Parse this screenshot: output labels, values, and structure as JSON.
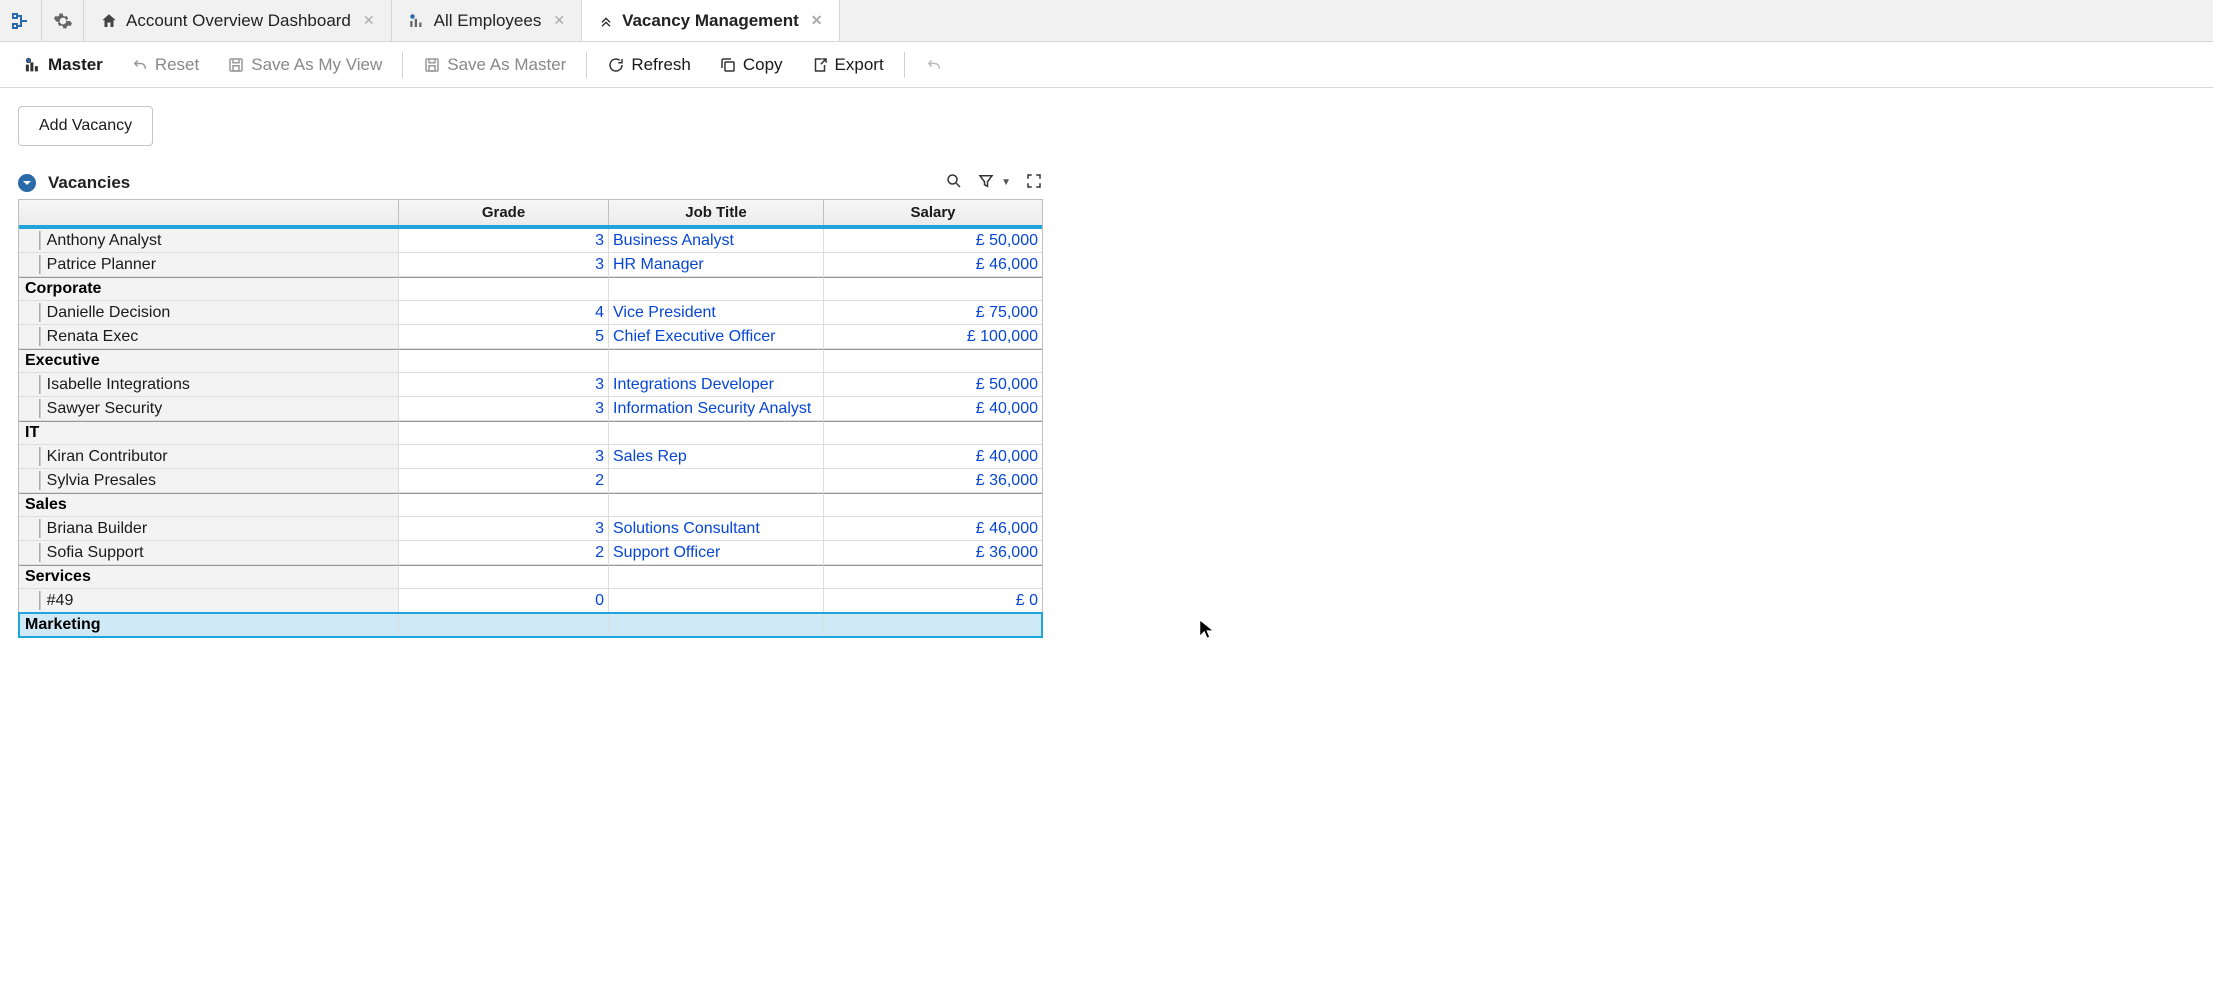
{
  "tabs": [
    {
      "label": "Account Overview Dashboard",
      "active": false,
      "icon": "home"
    },
    {
      "label": "All Employees",
      "active": false,
      "icon": "chart"
    },
    {
      "label": "Vacancy Management",
      "active": true,
      "icon": "chevrons"
    }
  ],
  "toolbar": {
    "master": "Master",
    "reset": "Reset",
    "saveView": "Save As My View",
    "saveMaster": "Save As Master",
    "refresh": "Refresh",
    "copy": "Copy",
    "export": "Export"
  },
  "actions": {
    "add_vacancy": "Add Vacancy"
  },
  "panel": {
    "title": "Vacancies"
  },
  "columns": {
    "grade": "Grade",
    "job_title": "Job Title",
    "salary": "Salary"
  },
  "rows": [
    {
      "type": "item",
      "name": "Anthony Analyst",
      "grade": "3",
      "job": "Business Analyst",
      "salary": "£ 50,000"
    },
    {
      "type": "item",
      "name": "Patrice Planner",
      "grade": "3",
      "job": "HR Manager",
      "salary": "£ 46,000"
    },
    {
      "type": "group",
      "name": "Corporate"
    },
    {
      "type": "item",
      "name": "Danielle Decision",
      "grade": "4",
      "job": "Vice President",
      "salary": "£ 75,000"
    },
    {
      "type": "item",
      "name": "Renata Exec",
      "grade": "5",
      "job": "Chief Executive Officer",
      "salary": "£ 100,000"
    },
    {
      "type": "group",
      "name": "Executive"
    },
    {
      "type": "item",
      "name": "Isabelle Integrations",
      "grade": "3",
      "job": "Integrations Developer",
      "salary": "£ 50,000"
    },
    {
      "type": "item",
      "name": "Sawyer Security",
      "grade": "3",
      "job": "Information Security Analyst",
      "salary": "£ 40,000"
    },
    {
      "type": "group",
      "name": "IT"
    },
    {
      "type": "item",
      "name": "Kiran Contributor",
      "grade": "3",
      "job": "Sales Rep",
      "salary": "£ 40,000"
    },
    {
      "type": "item",
      "name": "Sylvia Presales",
      "grade": "2",
      "job": "",
      "salary": "£ 36,000"
    },
    {
      "type": "group",
      "name": "Sales"
    },
    {
      "type": "item",
      "name": "Briana Builder",
      "grade": "3",
      "job": "Solutions Consultant",
      "salary": "£ 46,000"
    },
    {
      "type": "item",
      "name": "Sofia Support",
      "grade": "2",
      "job": "Support Officer",
      "salary": "£ 36,000"
    },
    {
      "type": "group",
      "name": "Services"
    },
    {
      "type": "item",
      "name": "#49",
      "grade": "0",
      "job": "",
      "salary": "£ 0"
    },
    {
      "type": "selected-group",
      "name": "Marketing"
    }
  ]
}
